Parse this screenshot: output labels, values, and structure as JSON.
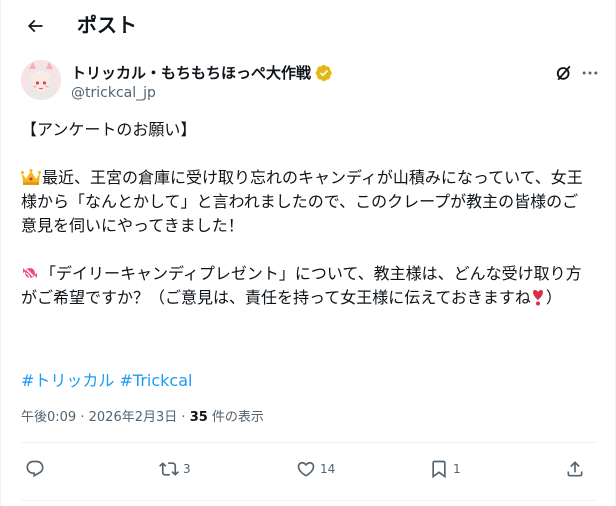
{
  "header": {
    "title": "ポスト"
  },
  "author": {
    "display_name": "トリッカル・もちもちほっぺ大作戦",
    "handle": "@trickcal_jp"
  },
  "post": {
    "heading": "【アンケートのお願い】",
    "para1": "最近、王宮の倉庫に受け取り忘れのキャンディが山積みになっていて、女王様から「なんとかして」と言われましたので、このクレープが教主の皆様のご意見を伺いにやってきました！",
    "para2_a": "「デイリーキャンディプレゼント」について、教主様は、どんな受け取り方がご希望ですか？（ご意見は、責任を持って女王様に伝えておきますね",
    "para2_b": "）",
    "hashtags": [
      "#トリッカル",
      "#Trickcal"
    ]
  },
  "meta": {
    "time": "午後0:09",
    "date": "2026年2月3日",
    "views_count": "35",
    "views_label": "件の表示",
    "dot": "·"
  },
  "actions": {
    "reply": "",
    "retweet": "3",
    "like": "14",
    "bookmark": "1"
  },
  "colors": {
    "accent": "#1d9bf0",
    "muted": "#536471",
    "verified_gold": "#e2b719",
    "heart": "#dd2e44"
  },
  "icons": [
    "back-arrow-icon",
    "verified-badge-icon",
    "grok-icon",
    "more-icon",
    "crown-icon",
    "candy-icon",
    "heart-exclamation-icon",
    "reply-icon",
    "retweet-icon",
    "like-icon",
    "bookmark-icon",
    "share-icon"
  ]
}
